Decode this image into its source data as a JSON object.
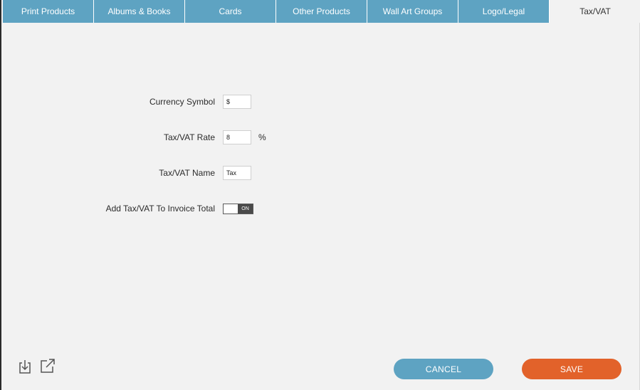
{
  "tabs": [
    {
      "label": "Print Products"
    },
    {
      "label": "Albums & Books"
    },
    {
      "label": "Cards"
    },
    {
      "label": "Other Products"
    },
    {
      "label": "Wall Art Groups"
    },
    {
      "label": "Logo/Legal"
    },
    {
      "label": "Tax/VAT",
      "active": true
    }
  ],
  "form": {
    "currency_symbol": {
      "label": "Currency Symbol",
      "value": "$"
    },
    "tax_rate": {
      "label": "Tax/VAT Rate",
      "value": "8",
      "unit": "%"
    },
    "tax_name": {
      "label": "Tax/VAT Name",
      "value": "Tax"
    },
    "add_to_invoice": {
      "label": "Add Tax/VAT To Invoice Total",
      "state": "ON"
    }
  },
  "footer": {
    "import_icon": "import-icon",
    "export_icon": "export-icon",
    "cancel_label": "CANCEL",
    "save_label": "SAVE"
  },
  "colors": {
    "tab_bg": "#5ea3c2",
    "save_button": "#e2622a",
    "cancel_button": "#5ea3c2"
  }
}
